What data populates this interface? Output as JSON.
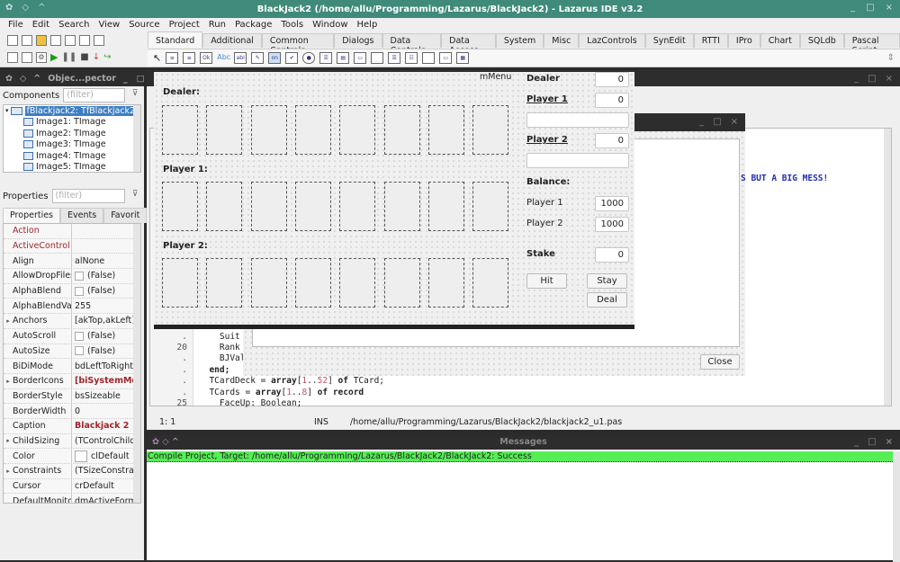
{
  "window": {
    "title": "BlackJack2 (/home/allu/Programming/Lazarus/BlackJack2) - Lazarus IDE v3.2",
    "controls": [
      "_",
      "□",
      "×"
    ]
  },
  "menu": [
    "File",
    "Edit",
    "Search",
    "View",
    "Source",
    "Project",
    "Run",
    "Package",
    "Tools",
    "Window",
    "Help"
  ],
  "palette_tabs": [
    "Standard",
    "Additional",
    "Common Controls",
    "Dialogs",
    "Data Controls",
    "Data Access",
    "System",
    "Misc",
    "LazControls",
    "SynEdit",
    "RTTI",
    "IPro",
    "Chart",
    "SQLdb",
    "Pascal Script"
  ],
  "palette_active": "Standard",
  "object_inspector": {
    "title": "Objec...pector",
    "components_label": "Components",
    "filter_placeholder": "(filter)",
    "tree": [
      {
        "label": "fBlackjack2: TfBlackjack2",
        "selected": true
      },
      {
        "label": "Image1: TImage"
      },
      {
        "label": "Image2: TImage"
      },
      {
        "label": "Image3: TImage"
      },
      {
        "label": "Image4: TImage"
      },
      {
        "label": "Image5: TImage"
      }
    ],
    "properties_label": "Properties",
    "tabs": [
      "Properties",
      "Events",
      "Favorit"
    ],
    "properties": [
      {
        "name": "Action",
        "value": "",
        "red": true
      },
      {
        "name": "ActiveControl",
        "value": "",
        "red": true
      },
      {
        "name": "Align",
        "value": "alNone"
      },
      {
        "name": "AllowDropFiles",
        "value": "(False)",
        "checkbox": true
      },
      {
        "name": "AlphaBlend",
        "value": "(False)",
        "checkbox": true
      },
      {
        "name": "AlphaBlendValue",
        "value": "255"
      },
      {
        "name": "Anchors",
        "value": "[akTop,akLeft]",
        "expandable": true
      },
      {
        "name": "AutoScroll",
        "value": "(False)",
        "checkbox": true
      },
      {
        "name": "AutoSize",
        "value": "(False)",
        "checkbox": true
      },
      {
        "name": "BiDiMode",
        "value": "bdLeftToRight"
      },
      {
        "name": "BorderIcons",
        "value": "[biSystemMenu,",
        "expandable": true,
        "bold_red": true
      },
      {
        "name": "BorderStyle",
        "value": "bsSizeable"
      },
      {
        "name": "BorderWidth",
        "value": "0"
      },
      {
        "name": "Caption",
        "value": "Blackjack 2",
        "bold_red": true
      },
      {
        "name": "ChildSizing",
        "value": "(TControlChildSiz",
        "expandable": true
      },
      {
        "name": "Color",
        "value": "clDefault",
        "colorbox": true
      },
      {
        "name": "Constraints",
        "value": "(TSizeConstraints",
        "expandable": true
      },
      {
        "name": "Cursor",
        "value": "crDefault"
      },
      {
        "name": "DefaultMonitor",
        "value": "dmActiveForm"
      }
    ]
  },
  "form": {
    "menu_component": "mMenu",
    "dealer_label": "Dealer:",
    "player1_label": "Player 1:",
    "player2_label": "Player 2:",
    "cards_per_row": 8,
    "score": {
      "dealer_label": "Dealer",
      "dealer_value": "0",
      "player1_label": "Player 1",
      "player1_value": "0",
      "player1_status": "",
      "player2_label": "Player 2",
      "player2_value": "0",
      "player2_status": ""
    },
    "balance_label": "Balance:",
    "balance_p1_label": "Player 1",
    "balance_p1_value": "1000",
    "balance_p2_label": "Player 2",
    "balance_p2_value": "1000",
    "stake_label": "Stake",
    "stake_value": "0",
    "hit_button": "Hit",
    "stay_button": "Stay",
    "deal_button": "Deal"
  },
  "about_form": {
    "memo_text": "S BUT A BIG MESS!",
    "close_button": "Close"
  },
  "editor": {
    "lines": [
      {
        "num": ".",
        "text": "    Suit"
      },
      {
        "num": "20",
        "text": "    Rank"
      },
      {
        "num": ".",
        "text": "    BJVal"
      },
      {
        "num": ".",
        "text": "  end;"
      },
      {
        "num": ".",
        "text": "  TCardDeck = array[1..52] of TCard;"
      },
      {
        "num": ".",
        "text": "  TCards = array[1..8] of record"
      },
      {
        "num": "25",
        "text": "    FaceUp: Boolean;"
      }
    ],
    "status_pos": "1: 1",
    "status_mode": "INS",
    "status_file": "/home/allu/Programming/Lazarus/BlackJack2/blackjack2_u1.pas"
  },
  "messages": {
    "title": "Messages",
    "line": "Compile Project, Target: /home/allu/Programming/Lazarus/BlackJack2/BlackJack2: Success",
    "success_color": "#55ee55"
  }
}
